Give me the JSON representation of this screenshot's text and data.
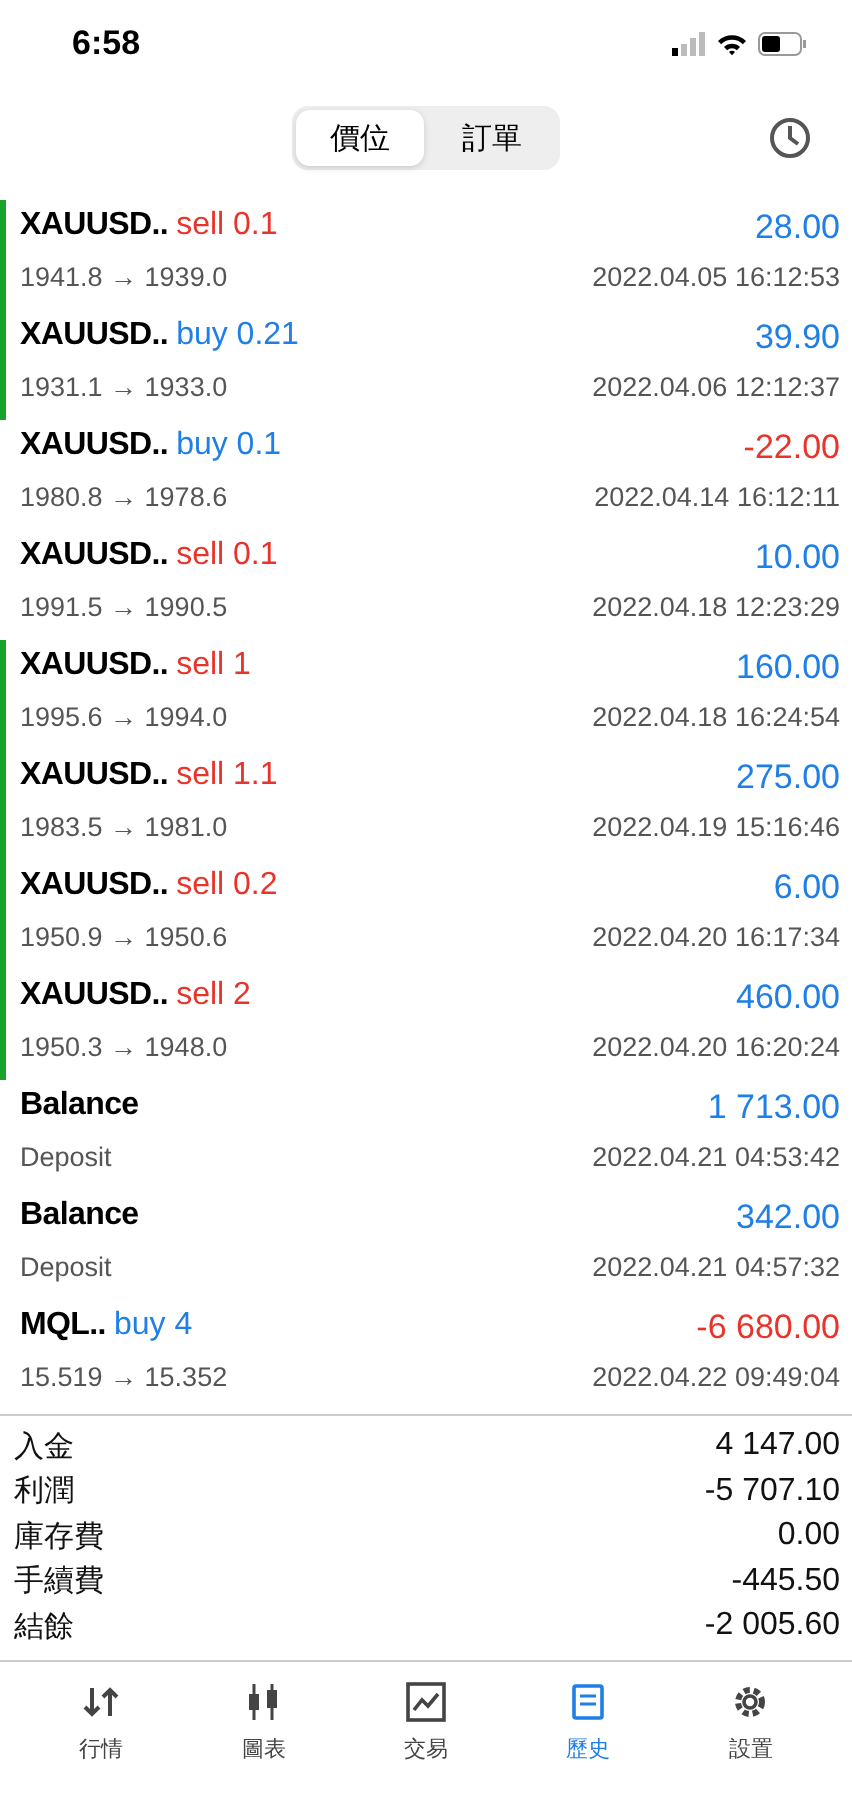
{
  "status_bar": {
    "time": "6:58"
  },
  "segments": [
    {
      "label": "價位",
      "selected": true
    },
    {
      "label": "訂單",
      "selected": false
    }
  ],
  "rows": [
    {
      "kind": "trade",
      "symbol": "XAUUSD..",
      "sell": true,
      "volume": "sell 0.1",
      "prices": "1941.8 → 1939.0",
      "profit": "28.00",
      "loss": false,
      "time": "2022.04.05 16:12:53",
      "marked": true
    },
    {
      "kind": "trade",
      "symbol": "XAUUSD..",
      "sell": false,
      "volume": "buy 0.21",
      "prices": "1931.1 → 1933.0",
      "profit": "39.90",
      "loss": false,
      "time": "2022.04.06 12:12:37",
      "marked": true
    },
    {
      "kind": "trade",
      "symbol": "XAUUSD..",
      "sell": false,
      "volume": "buy 0.1",
      "prices": "1980.8 → 1978.6",
      "profit": "-22.00",
      "loss": true,
      "time": "2022.04.14 16:12:11",
      "marked": false
    },
    {
      "kind": "trade",
      "symbol": "XAUUSD..",
      "sell": true,
      "volume": "sell 0.1",
      "prices": "1991.5 → 1990.5",
      "profit": "10.00",
      "loss": false,
      "time": "2022.04.18 12:23:29",
      "marked": false
    },
    {
      "kind": "trade",
      "symbol": "XAUUSD..",
      "sell": true,
      "volume": "sell 1",
      "prices": "1995.6 → 1994.0",
      "profit": "160.00",
      "loss": false,
      "time": "2022.04.18 16:24:54",
      "marked": true
    },
    {
      "kind": "trade",
      "symbol": "XAUUSD..",
      "sell": true,
      "volume": "sell 1.1",
      "prices": "1983.5 → 1981.0",
      "profit": "275.00",
      "loss": false,
      "time": "2022.04.19 15:16:46",
      "marked": true
    },
    {
      "kind": "trade",
      "symbol": "XAUUSD..",
      "sell": true,
      "volume": "sell 0.2",
      "prices": "1950.9 → 1950.6",
      "profit": "6.00",
      "loss": false,
      "time": "2022.04.20 16:17:34",
      "marked": true
    },
    {
      "kind": "trade",
      "symbol": "XAUUSD..",
      "sell": true,
      "volume": "sell 2",
      "prices": "1950.3 → 1948.0",
      "profit": "460.00",
      "loss": false,
      "time": "2022.04.20 16:20:24",
      "marked": true
    },
    {
      "kind": "balance",
      "symbol": "Balance",
      "prices": "Deposit",
      "profit": "1 713.00",
      "loss": false,
      "time": "2022.04.21 04:53:42",
      "marked": false
    },
    {
      "kind": "balance",
      "symbol": "Balance",
      "prices": "Deposit",
      "profit": "342.00",
      "loss": false,
      "time": "2022.04.21 04:57:32",
      "marked": false
    },
    {
      "kind": "trade",
      "symbol": "MQL..",
      "sell": false,
      "volume": "buy 4",
      "prices": "15.519 → 15.352",
      "profit": "-6 680.00",
      "loss": true,
      "time": "2022.04.22 09:49:04",
      "marked": false
    }
  ],
  "summary": [
    {
      "label": "入金",
      "value": "4 147.00"
    },
    {
      "label": "利潤",
      "value": "-5 707.10"
    },
    {
      "label": "庫存費",
      "value": "0.00"
    },
    {
      "label": "手續費",
      "value": "-445.50"
    },
    {
      "label": "結餘",
      "value": "-2 005.60"
    }
  ],
  "tabbar": [
    {
      "label": "行情",
      "selected": false
    },
    {
      "label": "圖表",
      "selected": false
    },
    {
      "label": "交易",
      "selected": false
    },
    {
      "label": "歷史",
      "selected": true
    },
    {
      "label": "設置",
      "selected": false
    }
  ]
}
